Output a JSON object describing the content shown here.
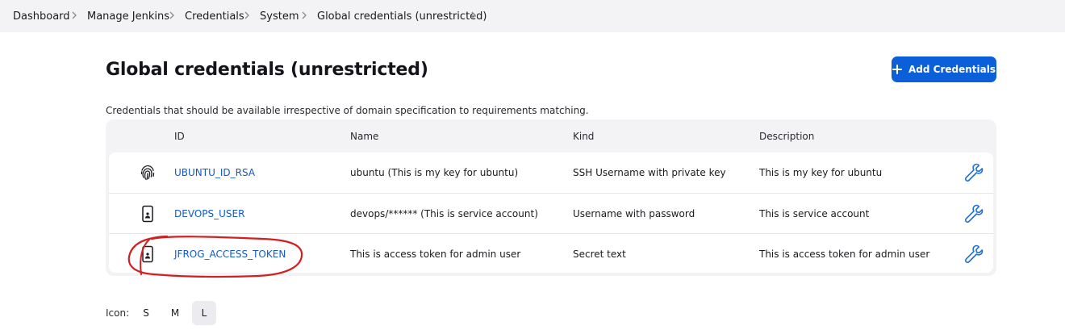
{
  "breadcrumb": {
    "items": [
      "Dashboard",
      "Manage Jenkins",
      "Credentials",
      "System",
      "Global credentials (unrestricted)"
    ]
  },
  "page": {
    "title": "Global credentials (unrestricted)",
    "add_button_label": "Add Credentials",
    "description": "Credentials that should be available irrespective of domain specification to requirements matching."
  },
  "table": {
    "headers": {
      "id": "ID",
      "name": "Name",
      "kind": "Kind",
      "description": "Description"
    },
    "rows": [
      {
        "icon": "fingerprint-icon",
        "id": "UBUNTU_ID_RSA",
        "name": "ubuntu (This is my key for ubuntu)",
        "kind": "SSH Username with private key",
        "description": "This is my key for ubuntu"
      },
      {
        "icon": "user-card-icon",
        "id": "DEVOPS_USER",
        "name": "devops/****** (This is service account)",
        "kind": "Username with password",
        "description": "This is service account"
      },
      {
        "icon": "user-card-icon",
        "id": "JFROG_ACCESS_TOKEN",
        "name": "This is access token for admin user",
        "kind": "Secret text",
        "description": "This is access token for admin user"
      }
    ]
  },
  "icon_size": {
    "label": "Icon:",
    "options": [
      "S",
      "M",
      "L"
    ],
    "selected": "L"
  },
  "colors": {
    "accent": "#0b5fd8",
    "link": "#1259c8",
    "annotation": "#d21f1f"
  }
}
